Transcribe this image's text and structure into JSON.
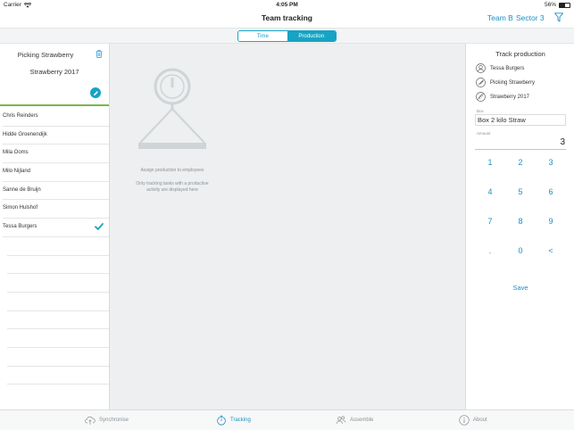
{
  "status_bar": {
    "carrier": "Carrier",
    "time": "4:05 PM",
    "battery": "56%",
    "battery_level": 0.56
  },
  "nav": {
    "title": "Team tracking",
    "team": "Team B",
    "sector": "Sector 3",
    "filter_icon": "filter-icon"
  },
  "segments": [
    {
      "label": "Time",
      "selected": false
    },
    {
      "label": "Production",
      "selected": true
    }
  ],
  "activity": {
    "name": "Picking Strawberry",
    "subtitle": "Strawberry 2017",
    "delete_icon": "trash-icon",
    "edit_icon": "pencil-icon",
    "accent": "#7ab648"
  },
  "employees": [
    {
      "name": "Chris Reinders",
      "checked": false
    },
    {
      "name": "Hidde Groenendijk",
      "checked": false
    },
    {
      "name": "Mila Ooms",
      "checked": false
    },
    {
      "name": "Milo Nijland",
      "checked": false
    },
    {
      "name": "Sanne de Bruijn",
      "checked": false
    },
    {
      "name": "Simon Hulshof",
      "checked": false
    },
    {
      "name": "Tessa Burgers",
      "checked": true
    }
  ],
  "center": {
    "empty_icon": "scale-icon",
    "assign_text": "Assign production to employees",
    "only_text_line1": "Only tracking tasks with a productive",
    "only_text_line2": "activity are displayed here"
  },
  "track": {
    "title": "Track production",
    "employee": "Tessa Burgers",
    "activity": "Picking Strawberry",
    "crop": "Strawberry 2017",
    "box_label": "Box",
    "box_value": "Box 2 kilo Straw",
    "amount_label": "Amount",
    "amount_value": "3",
    "keys": [
      "1",
      "2",
      "3",
      "4",
      "5",
      "6",
      "7",
      "8",
      "9",
      ".",
      "0",
      "<"
    ],
    "save_label": "Save"
  },
  "tabs": [
    {
      "label": "Synchronise",
      "icon": "cloud-sync-icon",
      "active": false
    },
    {
      "label": "Tracking",
      "icon": "stopwatch-icon",
      "active": true
    },
    {
      "label": "Assemble",
      "icon": "people-icon",
      "active": false
    },
    {
      "label": "About",
      "icon": "info-icon",
      "active": false
    }
  ],
  "colors": {
    "accent": "#17a3c4",
    "link": "#1a8fc9",
    "green": "#7ab648"
  }
}
